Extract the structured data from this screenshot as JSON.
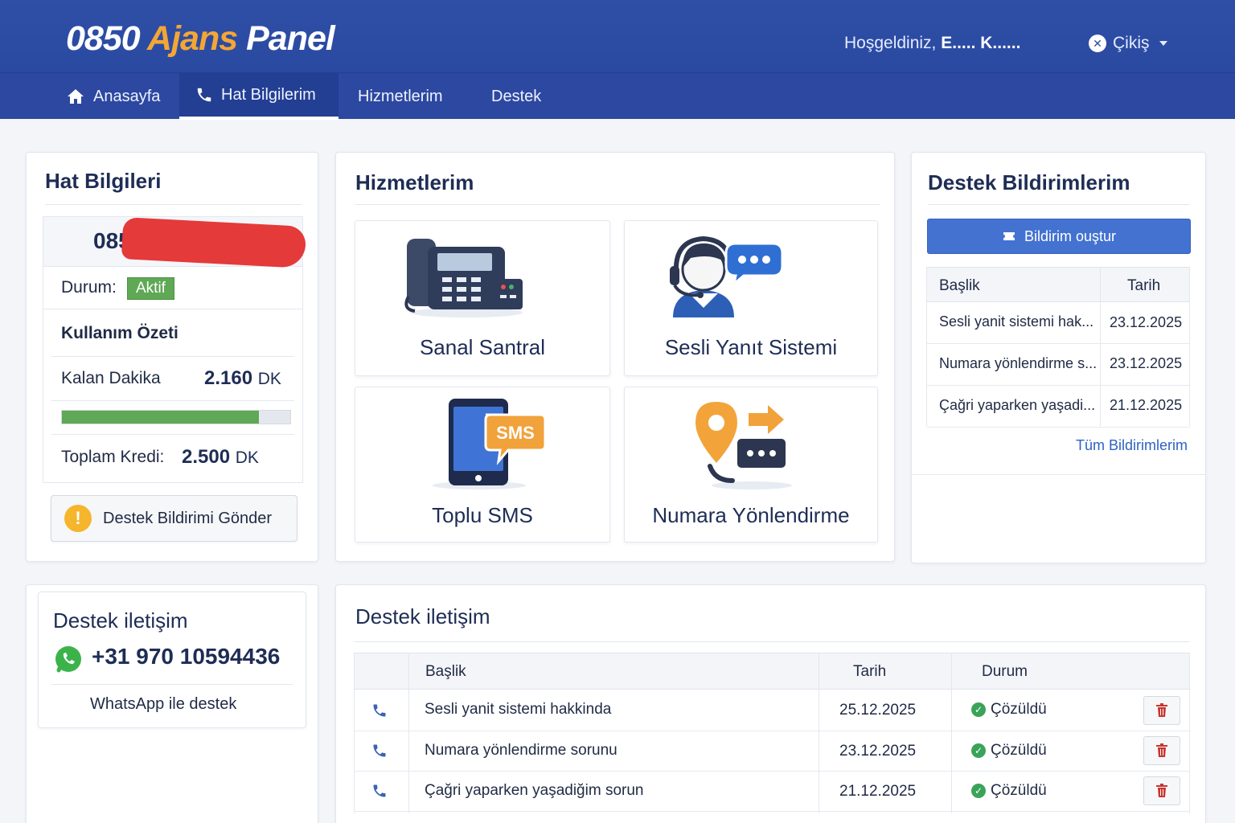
{
  "header": {
    "brand_part1": "0850",
    "brand_part2": "Ajans",
    "brand_part3": "Panel",
    "welcome_prefix": "Hoşgeldiniz,",
    "user_name": "E..... K......",
    "logout_label": "Çikiş"
  },
  "nav": {
    "items": [
      {
        "label": "Anasayfa",
        "icon": "home-icon"
      },
      {
        "label": "Hat Bilgilerim",
        "icon": "phone-icon"
      },
      {
        "label": "Hizmetlerim"
      },
      {
        "label": "Destek"
      }
    ],
    "active_index": 1
  },
  "hat": {
    "title": "Hat Bilgileri",
    "number_visible": "085",
    "durum_label": "Durum:",
    "durum_value": "Aktif",
    "usage_title": "Kullanım Özeti",
    "kalan_label": "Kalan Dakika",
    "kalan_value": "2.160",
    "unit": "DK",
    "usage_fraction": 0.864,
    "toplam_label": "Toplam Kredi:",
    "toplam_value": "2.500",
    "support_button": "Destek Bildirimi Gönder"
  },
  "services": {
    "title": "Hizmetlerim",
    "items": [
      {
        "label": "Sanal Santral",
        "icon": "desk-phone-icon"
      },
      {
        "label": "Sesli Yanıt Sistemi",
        "icon": "headset-agent-icon"
      },
      {
        "label": "Toplu SMS",
        "icon": "sms-phone-icon",
        "icon_text": "SMS"
      },
      {
        "label": "Numara Yönlendirme",
        "icon": "location-forward-icon"
      }
    ]
  },
  "notifications": {
    "title": "Destek Bildirimlerim",
    "create_button": "Bildirim ouştur",
    "col_title": "Başlik",
    "col_date": "Tarih",
    "rows": [
      {
        "title": "Sesli yanit sistemi hak...",
        "date": "23.12.2025"
      },
      {
        "title": "Numara yönlendirme s...",
        "date": "23.12.2025"
      },
      {
        "title": "Çağri yaparken yaşadi...",
        "date": "21.12.2025"
      }
    ],
    "all_link": "Tüm Bildirimlerim"
  },
  "contact_small": {
    "title": "Destek iletişim",
    "phone": "+31 970 10594436",
    "caption": "WhatsApp ile destek"
  },
  "contact_table": {
    "title": "Destek iletişim",
    "col_title": "Başlik",
    "col_date": "Tarih",
    "col_status": "Durum",
    "rows": [
      {
        "title": "Sesli yanit sistemi hakkinda",
        "date": "25.12.2025",
        "status": "Çözüldü"
      },
      {
        "title": "Numara yönlendirme sorunu",
        "date": "23.12.2025",
        "status": "Çözüldü"
      },
      {
        "title": "Çağri yaparken yaşadiğim sorun",
        "date": "21.12.2025",
        "status": "Çözüldü"
      }
    ]
  },
  "colors": {
    "header_blue": "#2c48a0",
    "accent_orange": "#f4a635",
    "active_green": "#5fa855",
    "primary_button": "#4372d1",
    "redaction_red": "#e43a3a"
  }
}
